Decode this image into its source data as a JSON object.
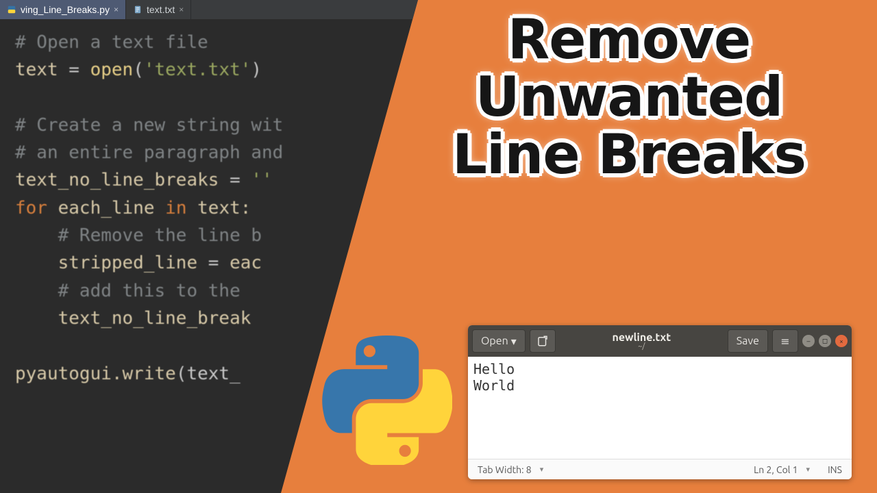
{
  "editor": {
    "tabs": [
      {
        "label": "ving_Line_Breaks.py",
        "active": true
      },
      {
        "label": "text.txt",
        "active": false
      }
    ],
    "code": {
      "l1": "# Open a text file",
      "l2a": "text ",
      "l2b": "= ",
      "l2c": "open",
      "l2d": "(",
      "l2e": "'text.txt'",
      "l2f": ")",
      "l3": "",
      "l4": "# Create a new string wit",
      "l5": "# an entire paragraph and",
      "l6a": "text_no_line_breaks ",
      "l6b": "= ",
      "l6c": "''",
      "l7a": "for ",
      "l7b": "each_line ",
      "l7c": "in ",
      "l7d": "text:",
      "l8": "    # Remove the line b",
      "l9a": "    stripped_line ",
      "l9b": "= ",
      "l9c": "eac",
      "l10": "    # add this to the ",
      "l11": "    text_no_line_break",
      "l12": "",
      "l13a": "pyautogui.write",
      "l13b": "(text_"
    }
  },
  "title": {
    "line1": "Remove",
    "line2": "Unwanted",
    "line3": "Line Breaks"
  },
  "gedit": {
    "open": "Open",
    "save": "Save",
    "filename": "newline.txt",
    "filedir": "~/",
    "body_l1": "Hello",
    "body_l2": "World",
    "status": {
      "tabwidth": "Tab Width: 8",
      "cursor": "Ln 2, Col 1",
      "mode": "INS"
    }
  }
}
